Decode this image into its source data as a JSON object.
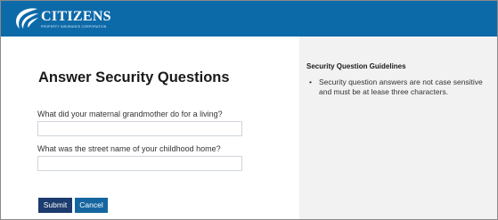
{
  "header": {
    "brand_name": "CITIZENS",
    "brand_tagline": "PROPERTY INSURANCE CORPORATION",
    "logo_icon": "citizens-swoosh-logo",
    "background": "#0d6aa8"
  },
  "main": {
    "title": "Answer Security Questions",
    "questions": [
      {
        "label": "What did your maternal grandmother do for a living?",
        "value": "",
        "placeholder": ""
      },
      {
        "label": "What was the street name of your childhood home?",
        "value": "",
        "placeholder": ""
      }
    ],
    "buttons": {
      "submit_label": "Submit",
      "cancel_label": "Cancel"
    }
  },
  "guidelines": {
    "title": "Security Question Guidelines",
    "items": [
      "Security question answers are not case sensitive and must be at lease three characters."
    ]
  },
  "colors": {
    "header": "#0d6aa8",
    "submit": "#1c3b6e",
    "cancel": "#1566a0",
    "sidebar": "#f2f2f2"
  }
}
